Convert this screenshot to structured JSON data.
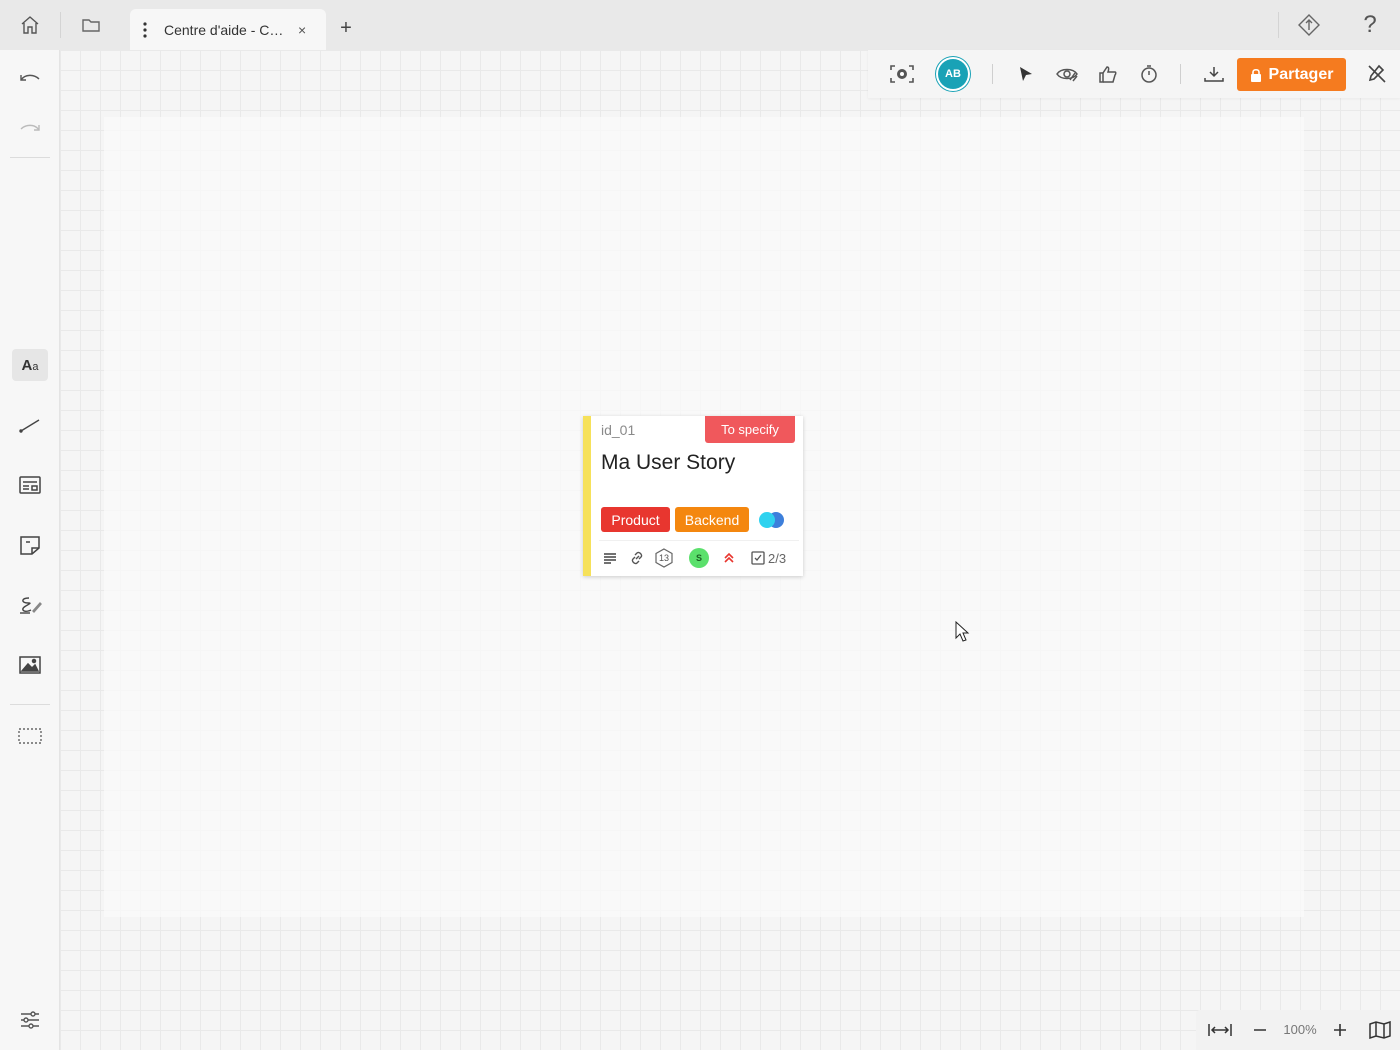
{
  "top_bar": {
    "tab_title": "Centre d'aide - Co...",
    "tab_close": "×",
    "new_tab": "+",
    "home_icon": "home-icon",
    "folder_icon": "folder-icon",
    "diamond_icon": "diamond-icon",
    "help": "?"
  },
  "sidebar": {
    "text_tool_big": "A",
    "text_tool_small": "a",
    "items": [
      "undo-icon",
      "redo-icon",
      "text-tool",
      "line-tool",
      "card-tool",
      "sticky-note-tool",
      "draw-tool",
      "image-tool",
      "selection-frame-tool",
      "settings-sliders-icon"
    ]
  },
  "toolbar": {
    "avatar_initials": "AB",
    "share_label": "Partager",
    "accent_color": "#f57b1f"
  },
  "card": {
    "id": "id_01",
    "status": "To specify",
    "title": "Ma User Story",
    "tags": [
      "Product",
      "Backend"
    ],
    "estimate": "13",
    "assignee_initial": "S",
    "checklist": "2/3",
    "stripe_color": "#f6e15a"
  },
  "zoom": {
    "value": "100%"
  }
}
